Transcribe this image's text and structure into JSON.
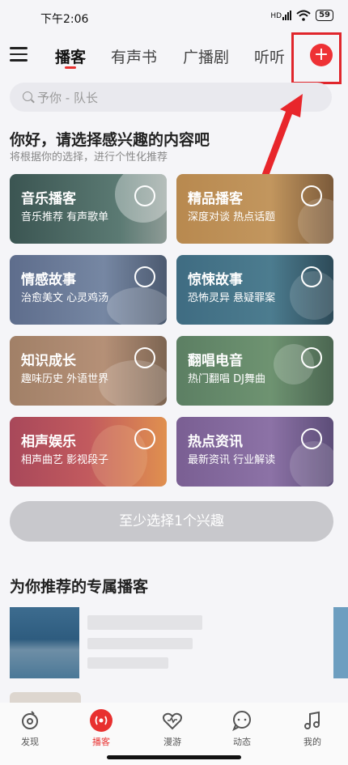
{
  "status_bar": {
    "time": "下午2:06",
    "network": "HD",
    "battery": "59"
  },
  "header": {
    "tabs": [
      {
        "label": "播客",
        "active": true
      },
      {
        "label": "有声书",
        "active": false
      },
      {
        "label": "广播剧",
        "active": false
      },
      {
        "label": "听听",
        "active": false
      }
    ],
    "add_button": "+"
  },
  "search": {
    "placeholder": "予你 - 队长"
  },
  "interests": {
    "title": "你好，请选择感兴趣的内容吧",
    "subtitle": "将根据你的选择，进行个性化推荐",
    "cards": [
      {
        "title": "音乐播客",
        "desc": "音乐推荐 有声歌单"
      },
      {
        "title": "精品播客",
        "desc": "深度对谈 热点话题"
      },
      {
        "title": "情感故事",
        "desc": "治愈美文 心灵鸡汤"
      },
      {
        "title": "惊悚故事",
        "desc": "恐怖灵异 悬疑罪案"
      },
      {
        "title": "知识成长",
        "desc": "趣味历史 外语世界"
      },
      {
        "title": "翻唱电音",
        "desc": "热门翻唱 DJ舞曲"
      },
      {
        "title": "相声娱乐",
        "desc": "相声曲艺 影视段子"
      },
      {
        "title": "热点资讯",
        "desc": "最新资讯 行业解读"
      }
    ],
    "confirm_button": "至少选择1个兴趣"
  },
  "recommend": {
    "title": "为你推荐的专属播客"
  },
  "bottom_nav": [
    {
      "label": "发现",
      "icon": "disc-icon"
    },
    {
      "label": "播客",
      "icon": "radio-icon",
      "active": true
    },
    {
      "label": "漫游",
      "icon": "heart-wave-icon"
    },
    {
      "label": "动态",
      "icon": "chat-icon"
    },
    {
      "label": "我的",
      "icon": "music-note-icon"
    }
  ],
  "colors": {
    "accent": "#e8302f",
    "highlight_box": "#e0262c"
  }
}
